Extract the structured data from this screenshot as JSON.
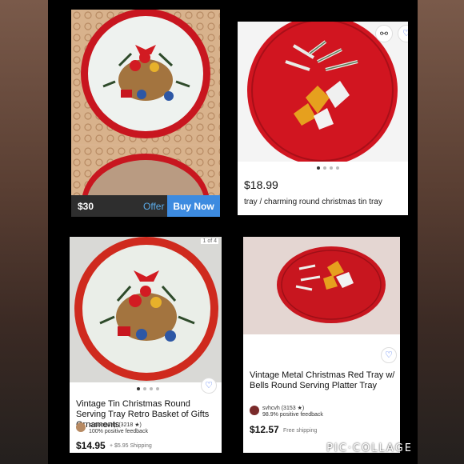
{
  "collage": {
    "watermark": "PIC·COLLAGE"
  },
  "panel1": {
    "price": "$30",
    "offer_label": "Offer",
    "buy_label": "Buy Now"
  },
  "panel2": {
    "share_icon": "share-icon",
    "price": "$18.99",
    "title": "tray / charming round christmas tin tray",
    "dots": 4,
    "active_dot": 0
  },
  "panel3": {
    "counter": "1 of 4",
    "title": "Vintage Tin Christmas Round Serving Tray Retro Basket of Gifts Ornaments",
    "seller_name": "suttonswap (3218 ★)",
    "seller_feedback": "100% positive feedback",
    "price": "$14.95",
    "shipping": "+ $5.95 Shipping"
  },
  "panel4": {
    "title": "Vintage Metal Christmas Red Tray w/ Bells  Round Serving Platter Tray",
    "seller_name": "svhcvh (3153 ★)",
    "seller_feedback": "98.9% positive feedback",
    "price": "$12.57",
    "shipping": "Free shipping"
  },
  "colors": {
    "tray_red": "#c8161f",
    "buy_blue": "#3d8be0",
    "ebay_blue": "#3665f3"
  }
}
